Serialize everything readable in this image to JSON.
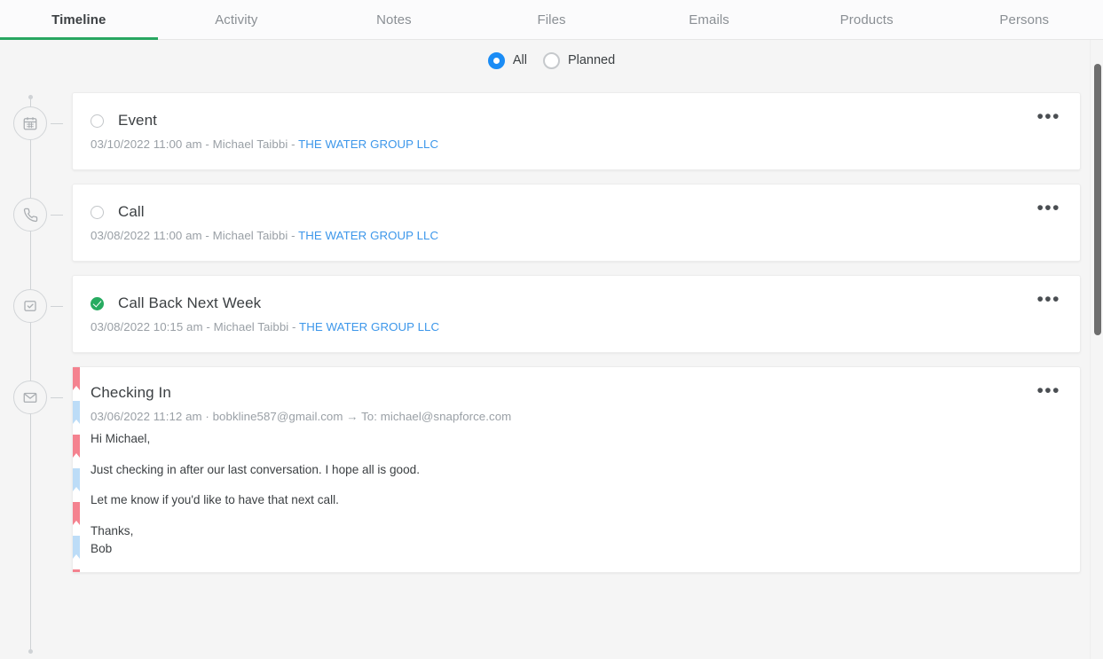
{
  "tabs": [
    {
      "label": "Timeline",
      "active": true
    },
    {
      "label": "Activity",
      "active": false
    },
    {
      "label": "Notes",
      "active": false
    },
    {
      "label": "Files",
      "active": false
    },
    {
      "label": "Emails",
      "active": false
    },
    {
      "label": "Products",
      "active": false
    },
    {
      "label": "Persons",
      "active": false
    }
  ],
  "filter": {
    "options": [
      {
        "label": "All",
        "selected": true
      },
      {
        "label": "Planned",
        "selected": false
      }
    ]
  },
  "colors": {
    "active_tab_underline": "#28a661",
    "radio_selected": "#1a8cf5",
    "link": "#3d97ea",
    "completed_check": "#27ab60",
    "ribbon_red": "#f4828f",
    "ribbon_blue": "#bcdcf7"
  },
  "timeline": [
    {
      "icon": "calendar-icon",
      "title": "Event",
      "completed": false,
      "meta_prefix": "03/10/2022 11:00 am - Michael Taibbi - ",
      "meta_link": "THE WATER GROUP LLC",
      "menu": "•••"
    },
    {
      "icon": "phone-icon",
      "title": "Call",
      "completed": false,
      "meta_prefix": "03/08/2022 11:00 am - Michael Taibbi - ",
      "meta_link": "THE WATER GROUP LLC",
      "menu": "•••"
    },
    {
      "icon": "task-icon",
      "title": "Call Back Next Week",
      "completed": true,
      "meta_prefix": "03/08/2022 10:15 am - Michael Taibbi - ",
      "meta_link": "THE WATER GROUP LLC",
      "menu": "•••"
    },
    {
      "icon": "envelope-icon",
      "title": "Checking In",
      "is_email": true,
      "meta_full": "03/06/2022 11:12 am · bobkline587@gmail.com → To: michael@snapforce.com",
      "menu": "•••",
      "body": [
        "Hi Michael,",
        "Just checking in after our last conversation. I hope all is good.",
        "Let me know if you'd like to have that next call.",
        "Thanks,",
        "Bob"
      ]
    }
  ]
}
